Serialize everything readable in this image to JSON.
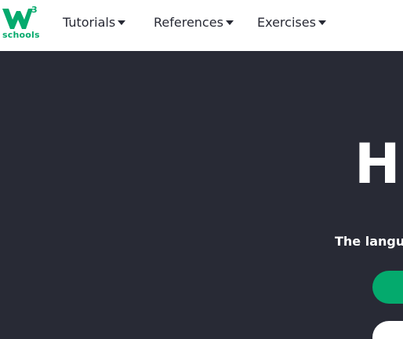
{
  "brand": {
    "logo_text": "schools",
    "logo_superscript": "3",
    "accent_color": "#04AA6D"
  },
  "nav": {
    "items": [
      {
        "label": "Tutorials",
        "icon": "caret-down-icon"
      },
      {
        "label": "References",
        "icon": "caret-down-icon"
      },
      {
        "label": "Exercises",
        "icon": "caret-down-icon"
      }
    ]
  },
  "hero": {
    "title": "H",
    "subtitle": "The langua",
    "background_color": "#282A35"
  }
}
